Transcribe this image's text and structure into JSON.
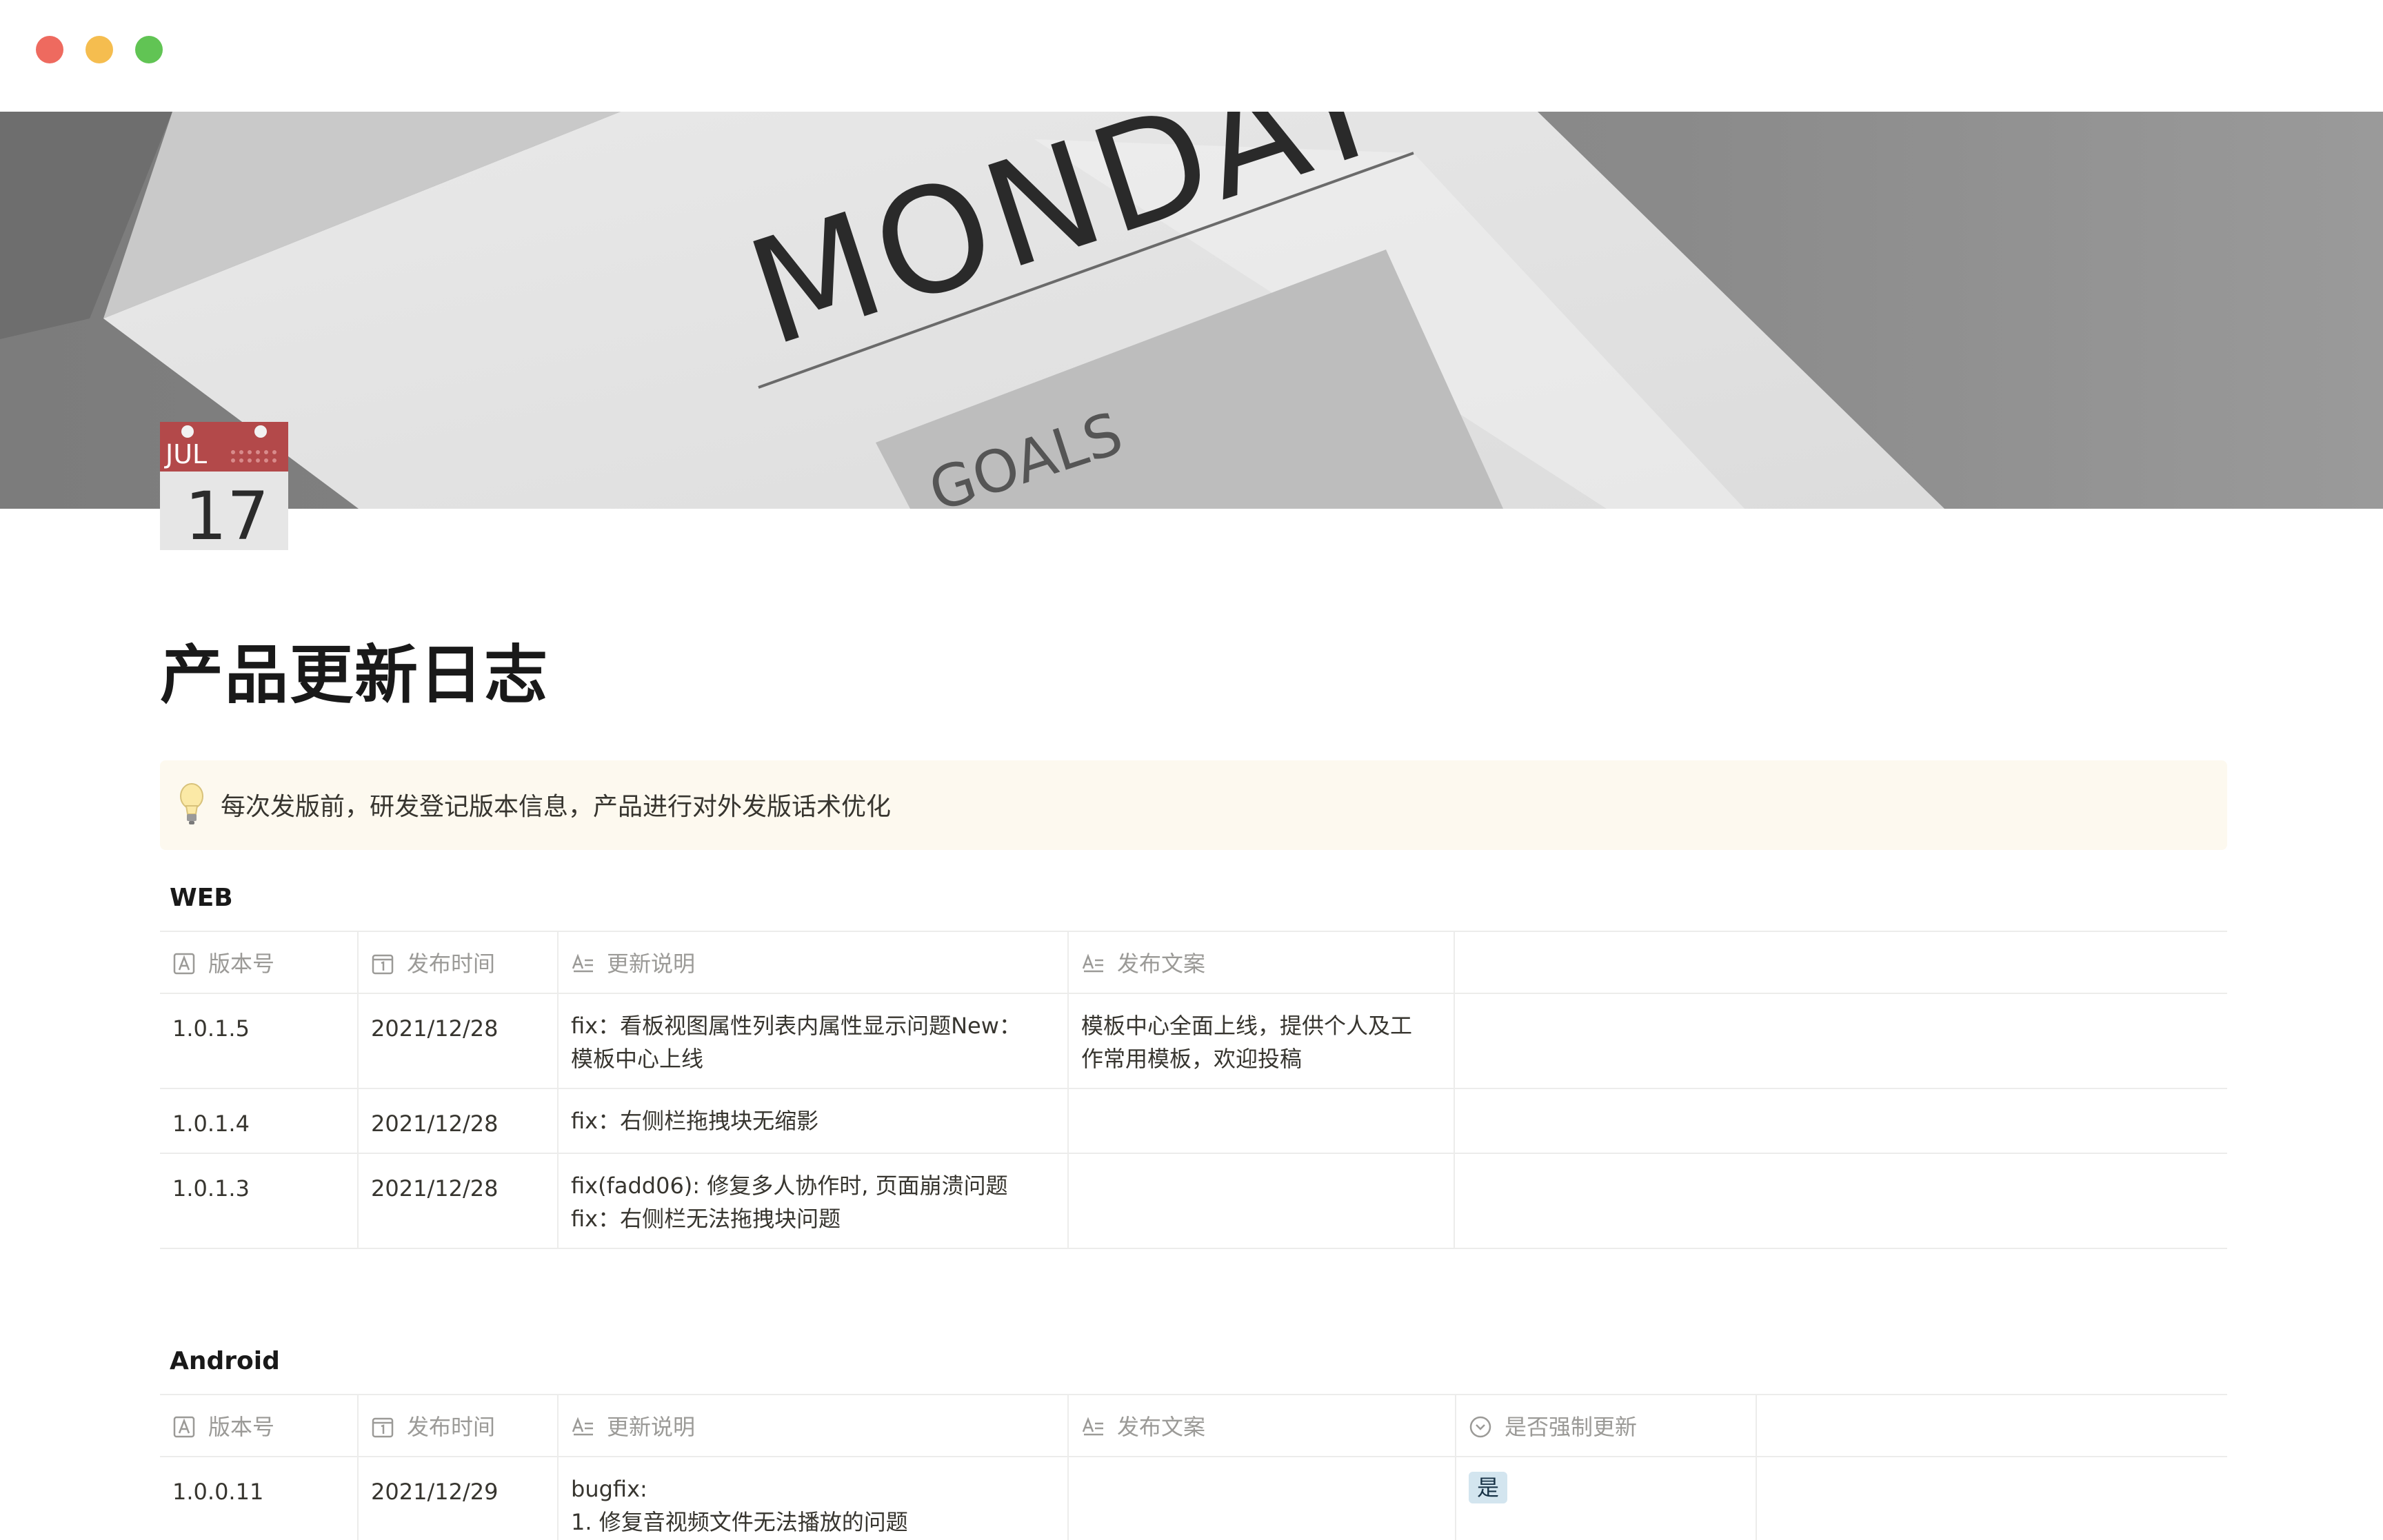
{
  "window": {
    "controls": [
      "close",
      "minimize",
      "maximize"
    ]
  },
  "cover": {
    "image_texts": [
      "MONDAY",
      "GOALS"
    ]
  },
  "page_icon": {
    "name": "calendar-icon",
    "month": "JUL",
    "day": "17",
    "colors": {
      "header": "#b3494a",
      "body": "#e6e6e6"
    }
  },
  "page": {
    "title": "产品更新日志"
  },
  "callout": {
    "icon": "lightbulb-icon",
    "text": "每次发版前，研发登记版本信息，产品进行对外发版话术优化"
  },
  "tables": {
    "web": {
      "title": "WEB",
      "headers": [
        {
          "icon": "text-property-icon",
          "label": "版本号"
        },
        {
          "icon": "date-property-icon",
          "label": "发布时间"
        },
        {
          "icon": "longtext-property-icon",
          "label": "更新说明"
        },
        {
          "icon": "longtext-property-icon",
          "label": "发布文案"
        }
      ],
      "rows": [
        {
          "version": "1.0.1.5",
          "date": "2021/12/28",
          "notes": [
            "fix：看板视图属性列表内属性显示问题New：",
            "模板中心上线"
          ],
          "copy": [
            "模板中心全面上线，提供个人及工",
            "作常用模板，欢迎投稿"
          ]
        },
        {
          "version": "1.0.1.4",
          "date": "2021/12/28",
          "notes": [
            "fix：右侧栏拖拽块无缩影"
          ],
          "copy": []
        },
        {
          "version": "1.0.1.3",
          "date": "2021/12/28",
          "notes": [
            "fix(fadd06): 修复多人协作时, 页面崩溃问题",
            "fix：右侧栏无法拖拽块问题"
          ],
          "copy": []
        }
      ]
    },
    "android": {
      "title": "Android",
      "headers": [
        {
          "icon": "text-property-icon",
          "label": "版本号"
        },
        {
          "icon": "date-property-icon",
          "label": "发布时间"
        },
        {
          "icon": "longtext-property-icon",
          "label": "更新说明"
        },
        {
          "icon": "longtext-property-icon",
          "label": "发布文案"
        },
        {
          "icon": "select-property-icon",
          "label": "是否强制更新"
        }
      ],
      "rows": [
        {
          "version": "1.0.0.11",
          "date": "2021/12/29",
          "notes": [
            "bugfix:",
            "1. 修复音视频文件无法播放的问题"
          ],
          "copy": [],
          "force_update": {
            "label": "是",
            "color": "#d3e5ef"
          }
        }
      ]
    }
  }
}
